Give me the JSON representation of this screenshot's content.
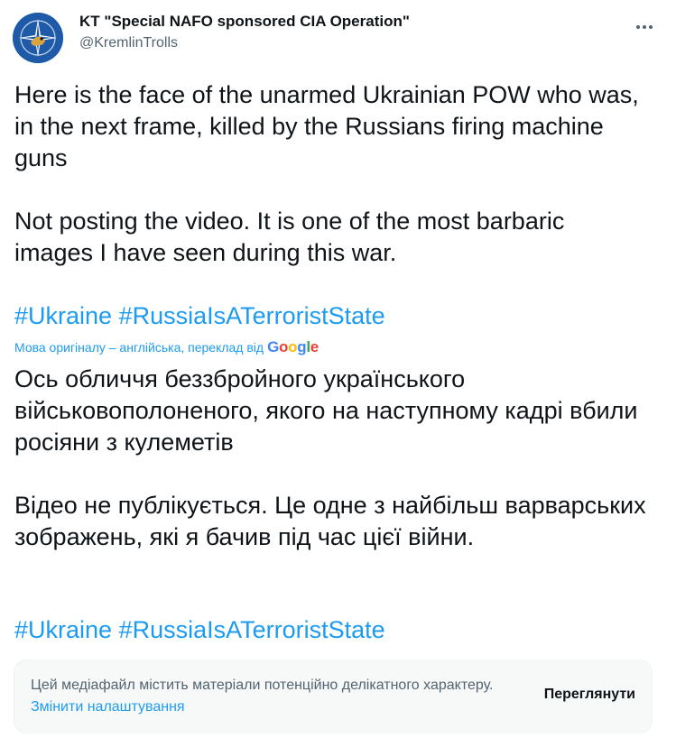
{
  "author": {
    "display_name": "KT \"Special NAFO sponsored CIA Operation\"",
    "handle": "@KremlinTrolls",
    "avatar_icon": "nafo-emblem-icon"
  },
  "tweet": {
    "line_1": "Here is the face of the unarmed Ukrainian POW who was, in the next frame, killed by the Russians firing machine guns",
    "line_2": "Not posting the video. It is one of the most barbaric images I have seen during this war.",
    "hashtags": [
      "#Ukraine",
      "#RussiaIsATerroristState"
    ]
  },
  "translation": {
    "note": "Мова оригіналу – англійська, переклад від",
    "provider": "Google",
    "line_1": "Ось обличчя беззбройного українського військовополоненого, якого на наступному кадрі вбили росіяни з кулеметів",
    "line_2": "Відео не публікується. Це одне з найбільш варварських зображень, які я бачив під час цієї війни.",
    "hashtags": [
      "#Ukraine",
      "#RussiaIsATerroristState"
    ]
  },
  "sensitive_media": {
    "message": "Цей медіафайл містить матеріали потенційно делікатного характеру.",
    "settings_link": "Змінити налаштування",
    "view_button": "Переглянути"
  },
  "colors": {
    "link": "#1d9bf0",
    "text": "#0f1419",
    "secondary": "#536471",
    "avatar_bg": "#1e5aa8"
  }
}
